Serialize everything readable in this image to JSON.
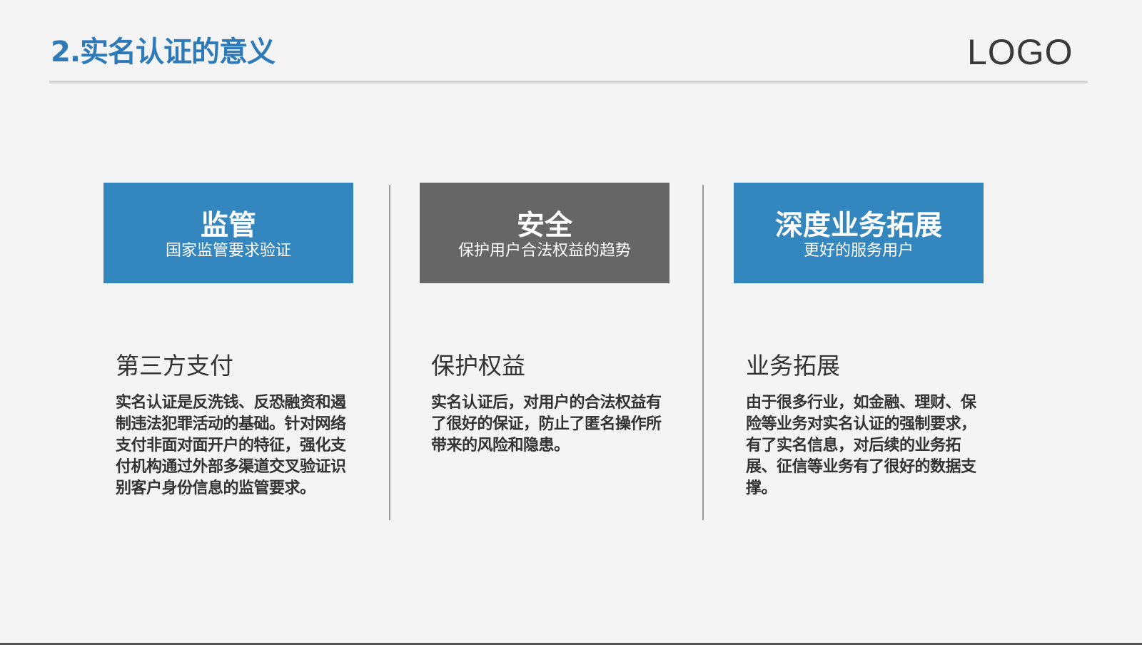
{
  "header": {
    "title": "2.实名认证的意义",
    "logo": "LOGO"
  },
  "colors": {
    "accent_blue": "#3386be",
    "gray_box": "#666666",
    "title_blue": "#2e7ab8",
    "text": "#333333"
  },
  "columns": [
    {
      "box_title": "监管",
      "box_subtitle": "国家监管要求验证",
      "heading": "第三方支付",
      "description": "实名认证是反洗钱、反恐融资和遏制违法犯罪活动的基础。针对网络支付非面对面开户的特征，强化支付机构通过外部多渠道交叉验证识别客户身份信息的监管要求。"
    },
    {
      "box_title": "安全",
      "box_subtitle": "保护用户合法权益的趋势",
      "heading": "保护权益",
      "description": "实名认证后，对用户的合法权益有了很好的保证，防止了匿名操作所带来的风险和隐患。"
    },
    {
      "box_title": "深度业务拓展",
      "box_subtitle": "更好的服务用户",
      "heading": "业务拓展",
      "description": "由于很多行业，如金融、理财、保险等业务对实名认证的强制要求，有了实名信息，对后续的业务拓展、征信等业务有了很好的数据支撑。"
    }
  ]
}
